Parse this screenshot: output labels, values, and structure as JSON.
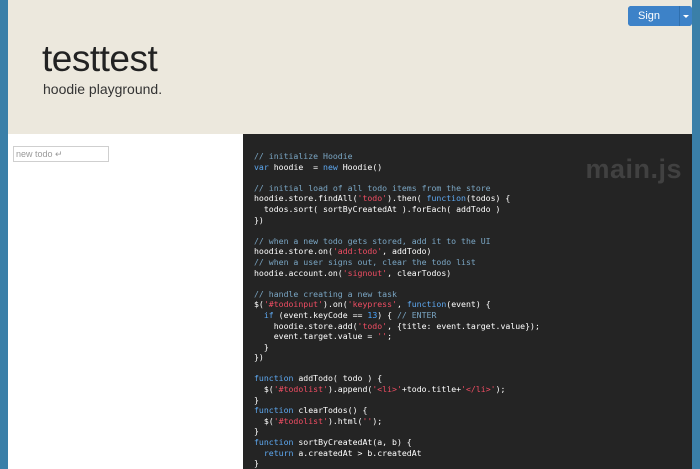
{
  "header": {
    "title": "testtest",
    "subtitle": "hoodie playground."
  },
  "signup": {
    "label": "Sign Up",
    "caret_icon": "chevron-down-icon"
  },
  "todo": {
    "placeholder": "new todo ↵"
  },
  "code": {
    "filename": "main.js",
    "lines": [
      "// initialize Hoodie",
      "var hoodie  = new Hoodie()",
      "",
      "// initial load of all todo items from the store",
      "hoodie.store.findAll('todo').then( function(todos) {",
      "  todos.sort( sortByCreatedAt ).forEach( addTodo )",
      "})",
      "",
      "// when a new todo gets stored, add it to the UI",
      "hoodie.store.on('add:todo', addTodo)",
      "// when a user signs out, clear the todo list",
      "hoodie.account.on('signout', clearTodos)",
      "",
      "// handle creating a new task",
      "$('#todoinput').on('keypress', function(event) {",
      "  if (event.keyCode == 13) { // ENTER",
      "    hoodie.store.add('todo', {title: event.target.value});",
      "    event.target.value = '';",
      "  }",
      "})",
      "",
      "function addTodo( todo ) {",
      "  $('#todolist').append('<li>'+todo.title+'</li>');",
      "}",
      "function clearTodos() {",
      "  $('#todolist').html('');",
      "}",
      "function sortByCreatedAt(a, b) {",
      "  return a.createdAt > b.createdAt",
      "}"
    ]
  }
}
